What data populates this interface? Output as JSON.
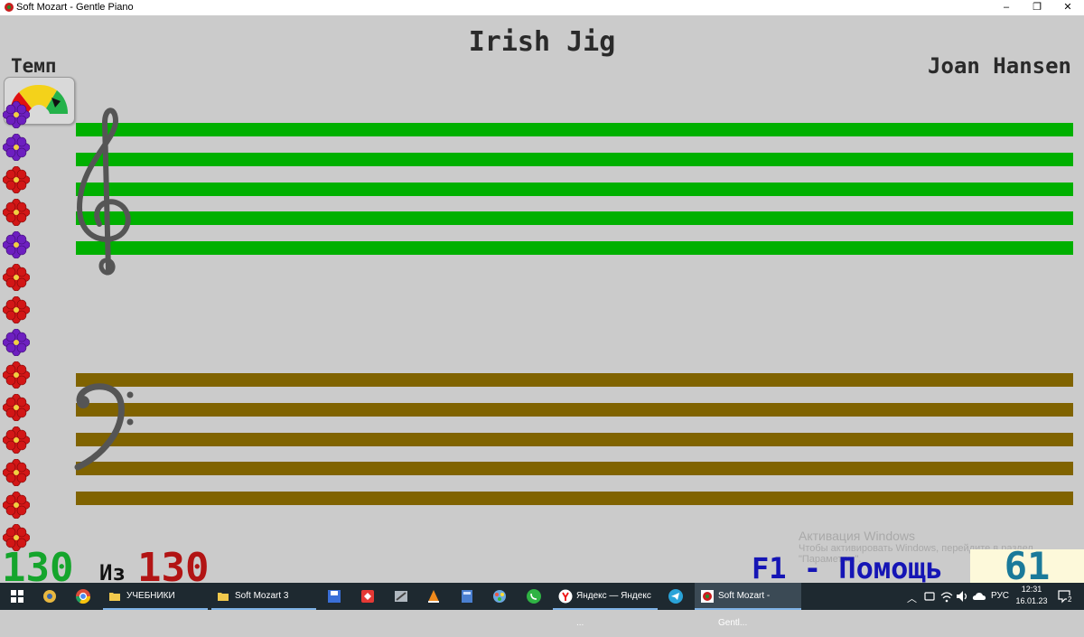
{
  "window": {
    "title": "Soft Mozart - Gentle Piano",
    "controls": {
      "minimize": "–",
      "restore": "❐",
      "close": "✕"
    }
  },
  "score": {
    "title": "Irish Jig",
    "composer": "Joan Hansen"
  },
  "tempo": {
    "label": "Темп"
  },
  "flowers": [
    {
      "color": "#6d1fc0"
    },
    {
      "color": "#6d1fc0"
    },
    {
      "color": "#d21616"
    },
    {
      "color": "#d21616"
    },
    {
      "color": "#6d1fc0"
    },
    {
      "color": "#d21616"
    },
    {
      "color": "#d21616"
    },
    {
      "color": "#6d1fc0"
    },
    {
      "color": "#d21616"
    },
    {
      "color": "#d21616"
    },
    {
      "color": "#d21616"
    },
    {
      "color": "#d21616"
    },
    {
      "color": "#d21616"
    },
    {
      "color": "#d21616"
    }
  ],
  "staves": {
    "treble_color": "#00b000",
    "bass_color": "#806300"
  },
  "status": {
    "count_done": "130",
    "of_label": "Из",
    "count_total": "130",
    "help": "F1 - Помощь",
    "points": "61"
  },
  "activation": {
    "heading": "Активация Windows",
    "line1": "Чтобы активировать Windows, перейдите в раздел",
    "line2": "\"Параметры\"."
  },
  "taskbar": {
    "items": [
      {
        "label": "УЧЕБНИКИ",
        "icon": "folder-icon"
      },
      {
        "label": "Soft Mozart 3",
        "icon": "folder-icon"
      },
      {
        "label": "Яндекс — Яндекс ...",
        "icon": "yandex-icon"
      },
      {
        "label": "Soft Mozart - Gentl...",
        "icon": "soft-mozart-icon"
      }
    ],
    "tray": {
      "language": "РУС",
      "time": "12:31",
      "date": "16.01.23",
      "notifications": "2"
    }
  }
}
